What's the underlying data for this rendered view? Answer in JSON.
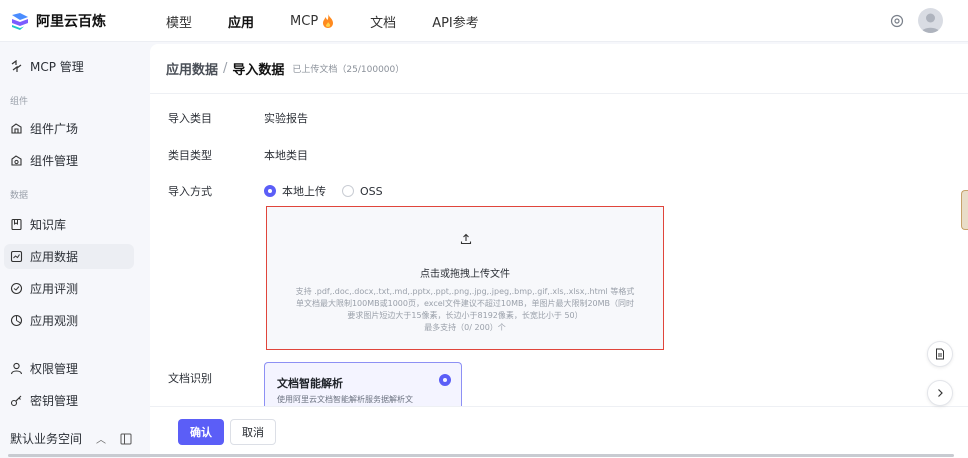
{
  "app": {
    "name": "阿里云百炼"
  },
  "topnav": {
    "items": [
      {
        "label": "模型"
      },
      {
        "label": "应用"
      },
      {
        "label": "MCP"
      },
      {
        "label": "文档"
      },
      {
        "label": "API参考"
      }
    ]
  },
  "sidebar": {
    "mcp_label": "MCP 管理",
    "group_components": "组件",
    "components_plaza": "组件广场",
    "components_manage": "组件管理",
    "group_data": "数据",
    "knowledge": "知识库",
    "app_data": "应用数据",
    "app_eval": "应用评测",
    "app_observe": "应用观测",
    "permissions": "权限管理",
    "keys": "密钥管理",
    "workspace": "默认业务空间"
  },
  "breadcrumb": {
    "parent": "应用数据",
    "separator": "/",
    "current": "导入数据",
    "note": "已上传文档（25/100000）"
  },
  "form": {
    "category_label": "导入类目",
    "category_value": "实验报告",
    "type_label": "类目类型",
    "type_value": "本地类目",
    "method_label": "导入方式",
    "method_options": [
      "本地上传",
      "OSS"
    ],
    "method_selected": "本地上传",
    "recognition_label": "文档识别"
  },
  "upload": {
    "title": "点击或拖拽上传文件",
    "line1": "支持 .pdf,.doc,.docx,.txt,.md,.pptx,.ppt,.png,.jpg,.jpeg,.bmp,.gif,.xls,.xlsx,.html 等格式",
    "line2": "单文档最大限制100MB或1000页，excel文件建议不超过10MB，单图片最大限制20MB（同时",
    "line3": "要求图片短边大于15像素，长边小于8192像素，长宽比小于 50）",
    "line4": "最多支持（0/ 200）个"
  },
  "parse_card": {
    "title": "文档智能解析",
    "description": "使用阿里云文档智能解析服务据解析文"
  },
  "footer": {
    "confirm": "确认",
    "cancel": "取消"
  },
  "colors": {
    "accent": "#5b5ef7",
    "upload_border": "#e0453b"
  }
}
